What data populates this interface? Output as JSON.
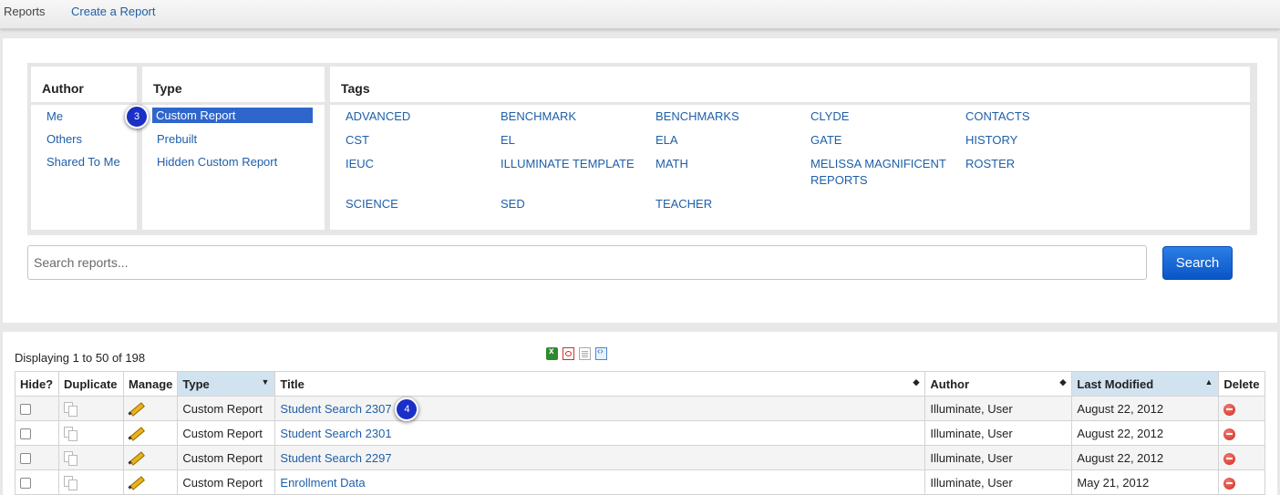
{
  "nav": {
    "reports": "Reports",
    "create": "Create a Report"
  },
  "filters": {
    "author": {
      "heading": "Author",
      "items": [
        "Me",
        "Others",
        "Shared To Me"
      ]
    },
    "type": {
      "heading": "Type",
      "items": [
        "Custom Report",
        "Prebuilt",
        "Hidden Custom Report"
      ],
      "selected": "Custom Report"
    },
    "tags": {
      "heading": "Tags",
      "items": [
        "ADVANCED",
        "BENCHMARK",
        "BENCHMARKS",
        "CLYDE",
        "CONTACTS",
        "CST",
        "EL",
        "ELA",
        "GATE",
        "HISTORY",
        "IEUC",
        "ILLUMINATE TEMPLATE",
        "MATH",
        "MELISSA MAGNIFICENT REPORTS",
        "ROSTER",
        "SCIENCE",
        "SED",
        "TEACHER"
      ]
    }
  },
  "badges": {
    "type": "3",
    "title": "4"
  },
  "search": {
    "placeholder": "Search reports...",
    "button": "Search"
  },
  "results": {
    "count": "Displaying 1 to 50 of 198",
    "exports": [
      "excel-export-icon",
      "pdf-export-icon",
      "text-export-icon",
      "code-export-icon"
    ],
    "columns": [
      "Hide?",
      "Duplicate",
      "Manage",
      "Type",
      "Title",
      "Author",
      "Last Modified",
      "Delete"
    ],
    "rows": [
      {
        "type": "Custom Report",
        "title": "Student Search 2307",
        "author": "Illuminate, User",
        "modified": "August 22, 2012"
      },
      {
        "type": "Custom Report",
        "title": "Student Search 2301",
        "author": "Illuminate, User",
        "modified": "August 22, 2012"
      },
      {
        "type": "Custom Report",
        "title": "Student Search 2297",
        "author": "Illuminate, User",
        "modified": "August 22, 2012"
      },
      {
        "type": "Custom Report",
        "title": "Enrollment Data",
        "author": "Illuminate, User",
        "modified": "May 21, 2012"
      }
    ]
  },
  "colors": {
    "link": "#1f5fa8",
    "selected": "#2f66cc",
    "button": "#0b55c6",
    "badge": "#1b30c6",
    "sorted_header": "#d2e3f0"
  }
}
